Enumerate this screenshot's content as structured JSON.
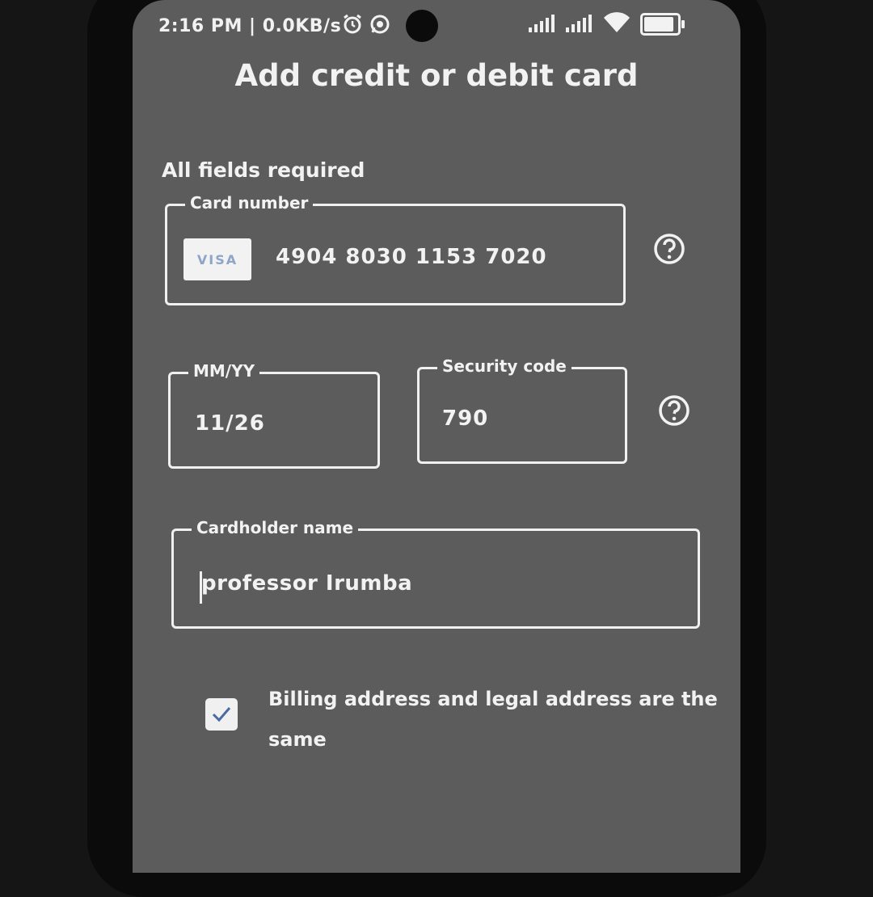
{
  "status_bar": {
    "time_speed": "2:16 PM | 0.0KB/s",
    "icons": [
      "alarm-icon",
      "whatsapp-icon",
      "signal-icon",
      "signal-icon",
      "wifi-icon",
      "battery-icon"
    ]
  },
  "page": {
    "title": "Add credit or debit card",
    "required_note": "All fields required"
  },
  "card_number": {
    "label": "Card number",
    "value": "4904 8030 1153 7020",
    "brand_logo_text": "VISA",
    "help_icon": "question-circle-icon"
  },
  "expiry": {
    "label": "MM/YY",
    "value": "11/26"
  },
  "security_code": {
    "label": "Security code",
    "value": "790",
    "help_icon": "question-circle-icon"
  },
  "cardholder": {
    "label": "Cardholder name",
    "value": "professor Irumba"
  },
  "billing": {
    "checked": true,
    "label": "Billing address and legal address are the same"
  },
  "colors": {
    "screen_bg": "#5c5c5c",
    "foreground": "#f2f2f2",
    "bezel": "#0b0b0b"
  }
}
